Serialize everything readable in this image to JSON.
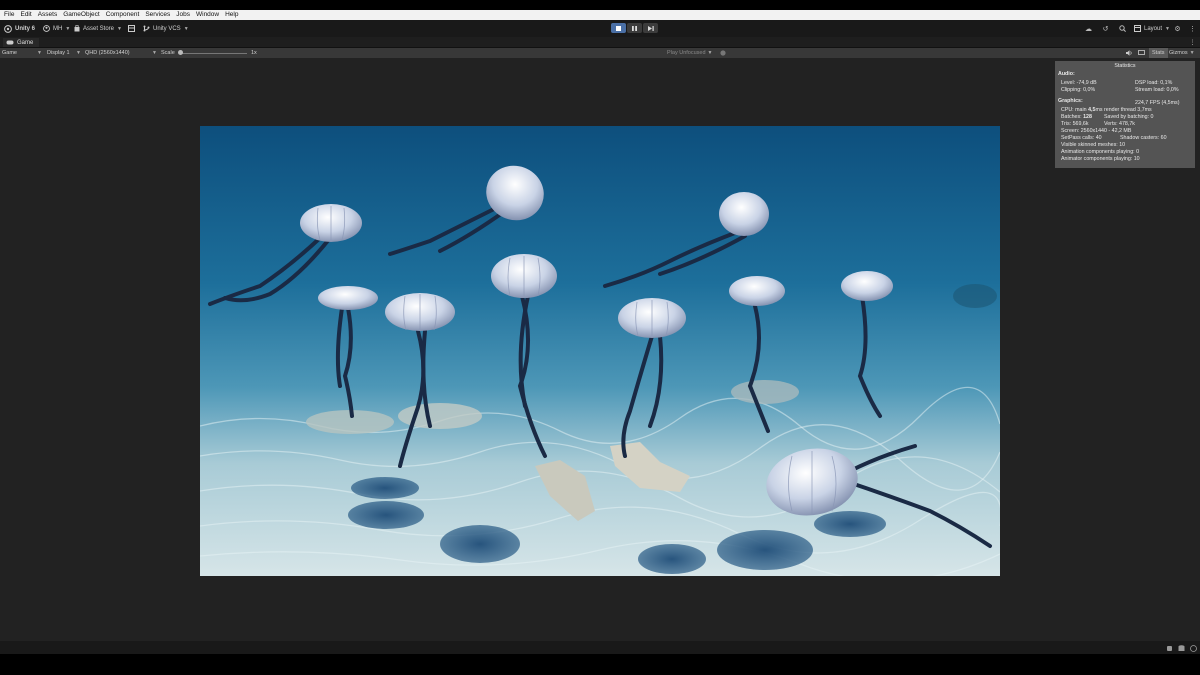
{
  "menu": [
    "File",
    "Edit",
    "Assets",
    "GameObject",
    "Component",
    "Services",
    "Jobs",
    "Window",
    "Help"
  ],
  "toolbar": {
    "account": "Unity 6",
    "user": "MH",
    "asset_store": "Asset Store",
    "vcs": "Unity VCS",
    "layout": "Layout"
  },
  "tab": {
    "label": "Game"
  },
  "gamebar": {
    "mode": "Game",
    "display": "Display 1",
    "resolution": "QHD (2560x1440)",
    "scale_label": "Scale",
    "scale_value": "1x",
    "play_focus": "Play Unfocused",
    "stats_button": "Stats",
    "gizmos": "Gizmos"
  },
  "stats": {
    "title": "Statistics",
    "audio_header": "Audio:",
    "level": "Level: -74,9 dB",
    "clipping": "Clipping: 0,0%",
    "dsp_load": "DSP load: 0,1%",
    "stream_load": "Stream load: 0,0%",
    "graphics_header": "Graphics:",
    "fps": "224,7 FPS (4,5ms)",
    "cpu_prefix": "CPU: main ",
    "cpu_main": "4,5",
    "cpu_suffix": "ms  render thread 3,7ms",
    "batches_prefix": "Batches: ",
    "batches": "128",
    "saved_batching": "Saved by batching: 0",
    "tris": "Tris: 569,6k",
    "verts": "Verts: 478,7k",
    "screen": "Screen: 2560x1440 - 42,2 MB",
    "setpass": "SetPass calls: 40",
    "shadow_casters": "Shadow casters: 60",
    "skinned": "Visible skinned meshes: 10",
    "anim_components": "Animation components playing: 0",
    "animator_components": "Animator components playing: 10"
  },
  "colors": {
    "editor_bg": "#222222",
    "toolbar_bg": "#191919",
    "play_active": "#4a6fa5",
    "stats_panel": "#5f5f5f"
  }
}
